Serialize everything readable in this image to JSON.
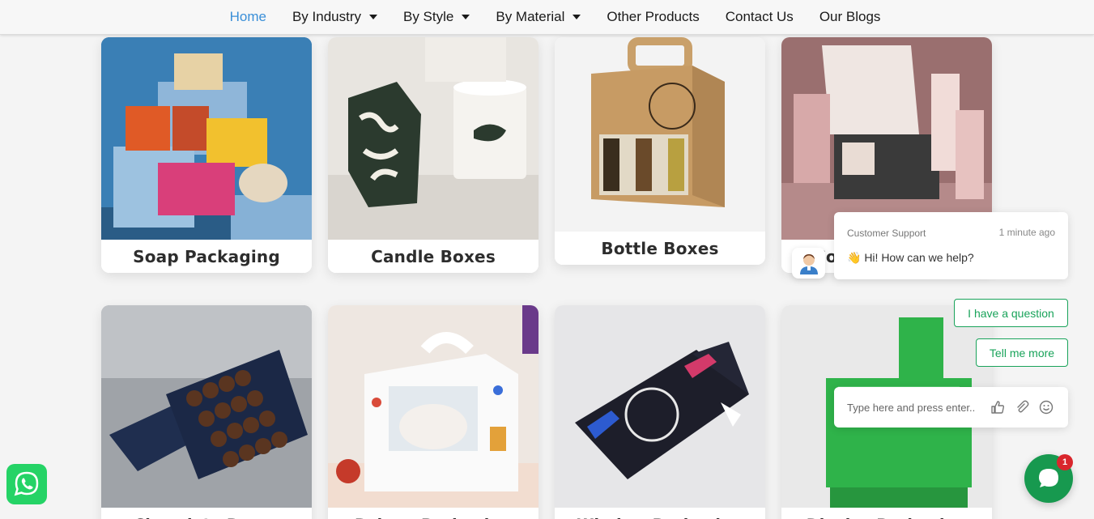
{
  "nav": {
    "items": [
      {
        "label": "Home",
        "active": true,
        "dropdown": false
      },
      {
        "label": "By Industry",
        "active": false,
        "dropdown": true
      },
      {
        "label": "By Style",
        "active": false,
        "dropdown": true
      },
      {
        "label": "By Material",
        "active": false,
        "dropdown": true
      },
      {
        "label": "Other Products",
        "active": false,
        "dropdown": false
      },
      {
        "label": "Contact Us",
        "active": false,
        "dropdown": false
      },
      {
        "label": "Our Blogs",
        "active": false,
        "dropdown": false
      }
    ],
    "active_color": "#3a8fd8"
  },
  "products": {
    "row1": [
      {
        "label": "Soap Packaging",
        "image": "soap-boxes-image"
      },
      {
        "label": "Candle Boxes",
        "image": "candle-boxes-image"
      },
      {
        "label": "Bottle Boxes",
        "image": "bottle-boxes-image"
      },
      {
        "label": "Cosmetic Boxes",
        "image": "cosmetic-boxes-image"
      }
    ],
    "row2": [
      {
        "label": "Chocolate Boxes",
        "image": "chocolate-box-image"
      },
      {
        "label": "Bakery Packaging",
        "image": "bakery-box-image"
      },
      {
        "label": "Window Packaging",
        "image": "window-box-image"
      },
      {
        "label": "Display Packaging",
        "image": "display-box-image"
      }
    ]
  },
  "chat": {
    "agent": "Customer Support",
    "time": "1 minute ago",
    "message": "👋 Hi! How can we help?",
    "quick_replies": [
      "I have a question",
      "Tell me more"
    ],
    "input_placeholder": "Type here and press enter..",
    "unread_count": "1",
    "brand_color": "#17994f"
  },
  "whatsapp": {
    "icon": "whatsapp-icon",
    "color": "#25d366"
  }
}
